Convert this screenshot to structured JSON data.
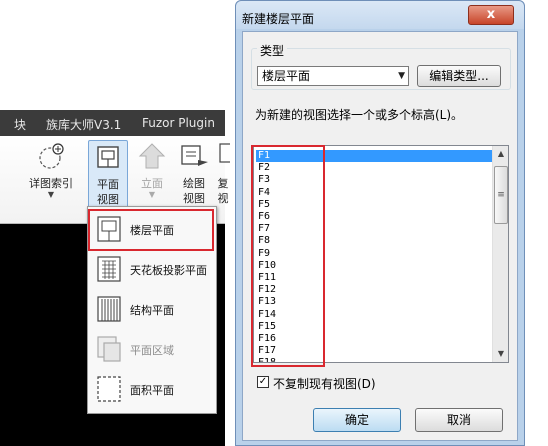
{
  "ribbon": {
    "tabs": [
      "块",
      "族库大师V3.1",
      "Fuzor Plugin"
    ],
    "buttons": {
      "detail_index": {
        "label": "详图索引"
      },
      "plan_view": {
        "line1": "平面",
        "line2": "视图"
      },
      "elevation": {
        "label": "立面"
      },
      "drafting_view": {
        "line1": "绘图",
        "line2": "视图"
      },
      "partial": {
        "line1": "复",
        "line2": "视"
      }
    }
  },
  "plan_menu": {
    "items": [
      {
        "label": "楼层平面",
        "icon": "floor-plan-icon"
      },
      {
        "label": "天花板投影平面",
        "icon": "ceiling-plan-icon"
      },
      {
        "label": "结构平面",
        "icon": "structural-plan-icon"
      },
      {
        "label": "平面区域",
        "icon": "plan-region-icon"
      },
      {
        "label": "面积平面",
        "icon": "area-plan-icon"
      }
    ]
  },
  "dialog": {
    "title": "新建楼层平面",
    "close_label": "x",
    "type_group_label": "类型",
    "type_value": "楼层平面",
    "edit_type_label": "编辑类型...",
    "instruction": "为新建的视图选择一个或多个标高(L)。",
    "levels": [
      "F1",
      "F2",
      "F3",
      "F4",
      "F5",
      "F6",
      "F7",
      "F8",
      "F9",
      "F10",
      "F11",
      "F12",
      "F13",
      "F14",
      "F15",
      "F16",
      "F17",
      "F18"
    ],
    "selected_level": "F1",
    "no_duplicate_label": "不复制现有视图(D)",
    "no_duplicate_checked": true,
    "ok_label": "确定",
    "cancel_label": "取消"
  },
  "colors": {
    "highlight_box": "#d9282f",
    "selection": "#3399ff",
    "dialog_frame": "#b9d1ea"
  }
}
